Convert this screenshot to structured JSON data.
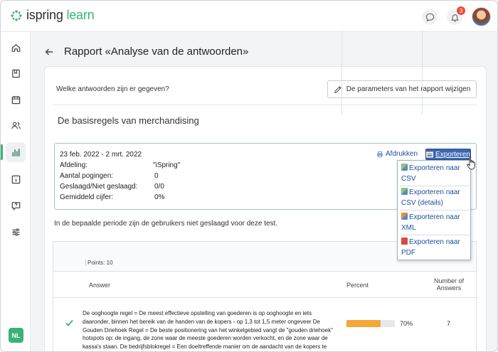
{
  "brand": {
    "name_part1": "ispring",
    "name_part2": "learn",
    "color": "#3bb273"
  },
  "topbar": {
    "notifications_count": "3"
  },
  "sidebar": {
    "items": [
      {
        "name": "home-icon"
      },
      {
        "name": "book-icon"
      },
      {
        "name": "calendar-icon"
      },
      {
        "name": "users-icon"
      },
      {
        "name": "reports-icon",
        "active": true
      },
      {
        "name": "info-icon"
      },
      {
        "name": "help-icon"
      },
      {
        "name": "settings-icon"
      }
    ],
    "user_initials": "NL"
  },
  "page": {
    "title": "Rapport «Analyse van de antwoorden»"
  },
  "toolbar": {
    "question": "Welke antwoorden zijn er gegeven?",
    "params_button": "De parameters van het rapport wijzigen"
  },
  "course": {
    "title": "De basisregels van merchandising"
  },
  "report": {
    "date_range": "23 feb. 2022 - 2 mrt. 2022",
    "rows": [
      {
        "label": "Afdeling:",
        "value": "\"iSpring\""
      },
      {
        "label": "Aantal pogingen:",
        "value": "0"
      },
      {
        "label": "Geslaagd/Niet geslaagd:",
        "value": "0/0"
      },
      {
        "label": "Gemiddeld cijfer:",
        "value": "0%"
      }
    ],
    "print_label": "Afdrukken",
    "export_label": "Exporteren",
    "export_menu": [
      {
        "line1": "Exporteren naar",
        "line2": "CSV",
        "type": "csv"
      },
      {
        "line1": "Exporteren naar",
        "line2": "CSV (details)",
        "type": "csv"
      },
      {
        "line1": "Exporteren naar",
        "line2": "XML",
        "type": "xml"
      },
      {
        "line1": "Exporteren naar",
        "line2": "PDF",
        "type": "pdf"
      }
    ]
  },
  "info_text": "In de bepaalde periode zijn de gebruikers niet geslaagd voor deze test.",
  "table": {
    "points_label": "Points: 10",
    "headers": {
      "answer": "Answer",
      "percent": "Percent",
      "number_line1": "Number of",
      "number_line2": "Answers"
    },
    "rows": [
      {
        "answer": "De ooghoogte regel = De meest effectieve opstelling van goederen is op ooghoogte en iets daaronder, binnen het bereik van de handen van de kopers - op 1,3 tot 1,5 meter ongeveer De Gouden Driehoek Regel = De beste positionering van het winkelgebied vangt de \"gouden driehoek\" hotspots op: de ingang, de zone waar de meeste goederen worden verkocht, en de zone waar de kassa's staan. De bedrijfsblokregel = Een doeltreffende manier om de aandacht van de kopers te trekken is",
        "percent": 70,
        "percent_label": "70%",
        "count": "7",
        "correct": true
      }
    ]
  },
  "colors": {
    "accent": "#3bb273",
    "link": "#1e4fa0",
    "export_button": "#3b67b0",
    "bar": "#f6a73a",
    "badge": "#e74c3c"
  }
}
